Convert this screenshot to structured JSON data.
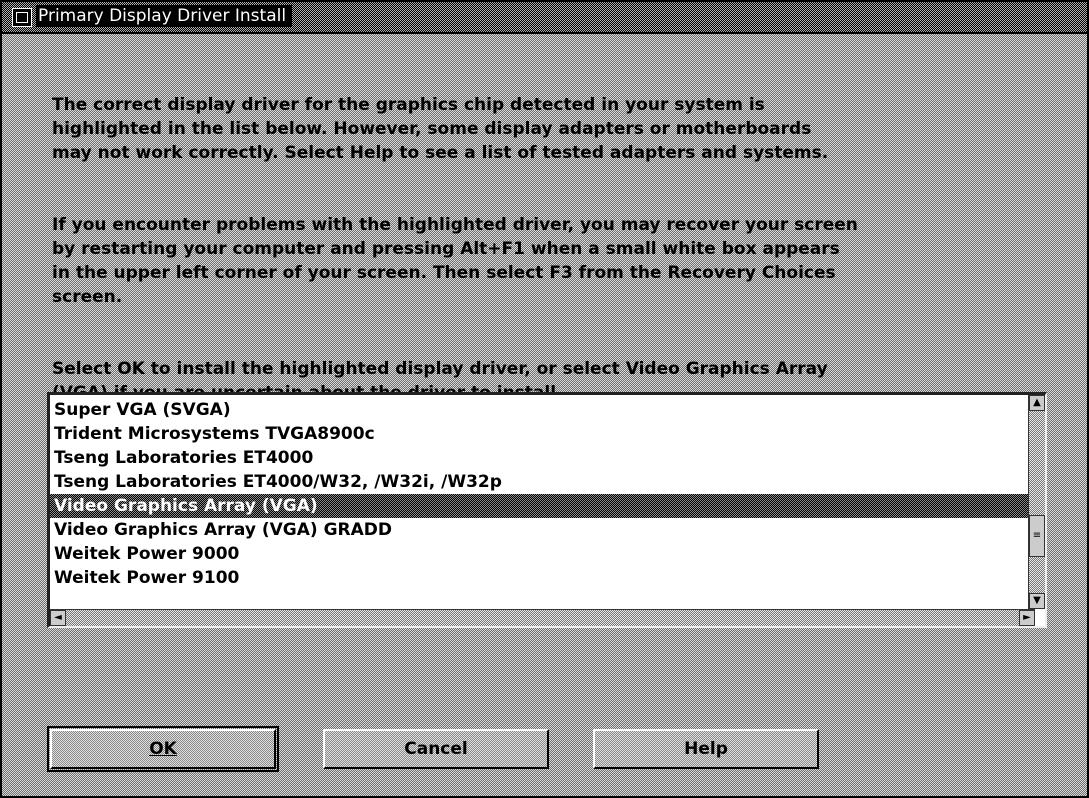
{
  "window": {
    "title": "Primary Display Driver Install"
  },
  "message": {
    "paragraph1": "The correct display driver for the graphics chip detected in your system is\nhighlighted in the list below.  However, some display adapters or motherboards\nmay not work correctly.  Select Help to see a list of tested adapters and systems.",
    "paragraph2": "If you encounter problems with the highlighted driver, you may recover your screen\nby restarting your computer and pressing Alt+F1 when a small white box appears\nin the upper left corner of your screen.  Then select F3 from the Recovery Choices\nscreen.",
    "paragraph3": "Select OK to install the highlighted display driver, or select Video Graphics Array\n(VGA) if you are uncertain about the driver to install."
  },
  "driver_list": {
    "items": [
      "Super VGA (SVGA)",
      "Trident Microsystems TVGA8900c",
      "Tseng Laboratories ET4000",
      "Tseng Laboratories ET4000/W32, /W32i, /W32p",
      "Video Graphics Array (VGA)",
      "Video Graphics Array (VGA) GRADD",
      "Weitek Power 9000",
      "Weitek Power 9100"
    ],
    "selected": "Video Graphics Array (VGA)"
  },
  "buttons": {
    "ok": "OK",
    "cancel": "Cancel",
    "help": "Help"
  }
}
